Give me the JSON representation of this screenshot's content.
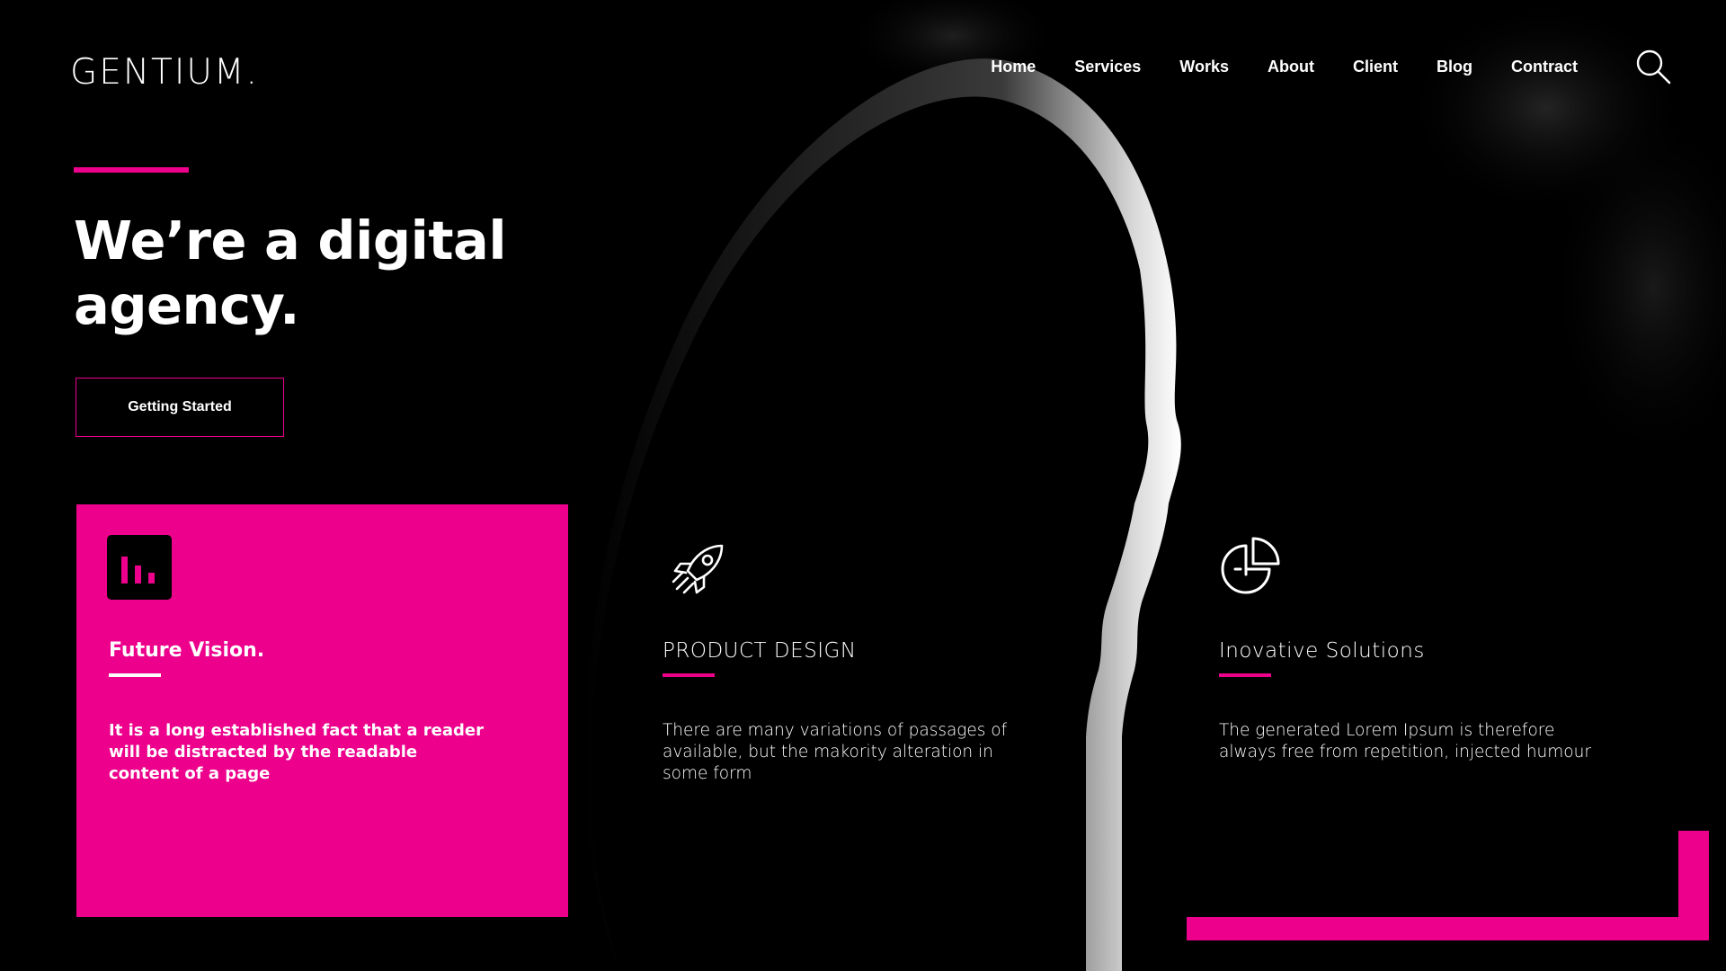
{
  "brand": {
    "logo": "GENTIUM."
  },
  "nav": {
    "items": [
      {
        "label": "Home"
      },
      {
        "label": "Services"
      },
      {
        "label": "Works"
      },
      {
        "label": "About"
      },
      {
        "label": "Client"
      },
      {
        "label": "Blog"
      },
      {
        "label": "Contract"
      }
    ],
    "search_icon": "search-icon"
  },
  "hero": {
    "title_line1": "We’re a digital",
    "title_line2": "agency.",
    "cta_label": "Getting Started"
  },
  "features": [
    {
      "icon": "bar-chart-icon",
      "title": "Future Vision.",
      "text": "It is a long established fact that a reader will be distracted by the readable content of a page"
    },
    {
      "icon": "rocket-icon",
      "title": "PRODUCT DESIGN",
      "text": "There are many variations of passages of available, but the makority alteration in some form"
    },
    {
      "icon": "pie-chart-icon",
      "title": "Inovative Solutions",
      "text": "The generated Lorem Ipsum is therefore always free from repetition, injected humour"
    }
  ],
  "colors": {
    "accent": "#ec008c",
    "background": "#000000",
    "text": "#ffffff"
  }
}
